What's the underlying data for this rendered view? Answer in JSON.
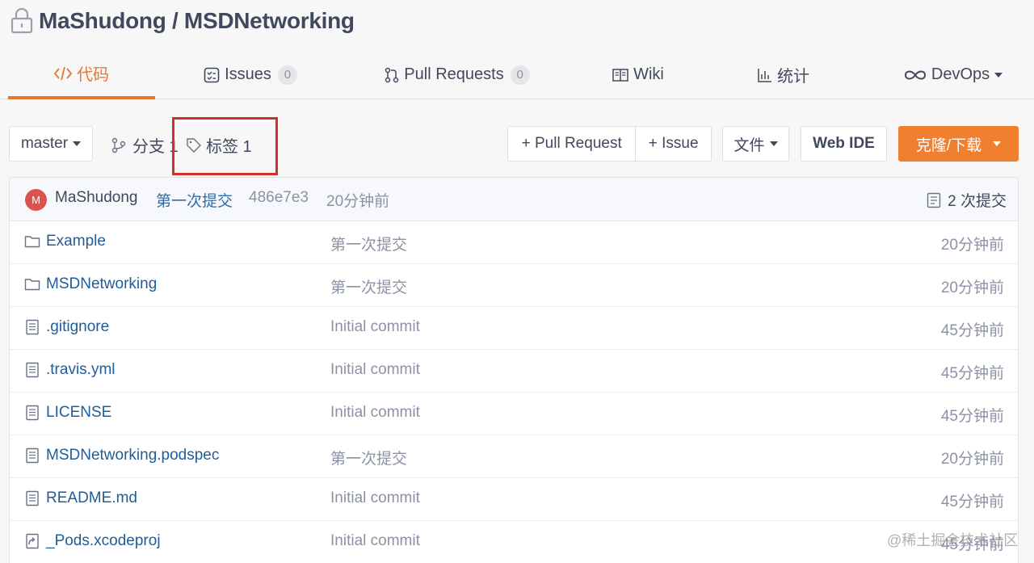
{
  "repo": {
    "title": "MaShudong / MSDNetworking"
  },
  "tabs": [
    {
      "label": "代码",
      "icon": "code-icon"
    },
    {
      "label": "Issues",
      "badge": "0",
      "icon": "issues-icon"
    },
    {
      "label": "Pull Requests",
      "badge": "0",
      "icon": "pull-request-icon"
    },
    {
      "label": "Wiki",
      "icon": "wiki-icon"
    },
    {
      "label": "统计",
      "icon": "chart-icon"
    },
    {
      "label": "DevOps",
      "icon": "infinity-icon"
    }
  ],
  "toolbar": {
    "branch": "master",
    "branches_label": "分支 1",
    "tags_label": "标签 1",
    "pull_request": "+ Pull Request",
    "issue": "+ Issue",
    "file": "文件",
    "web_ide": "Web IDE",
    "clone": "克隆/下载"
  },
  "last_commit": {
    "avatar_letter": "M",
    "author": "MaShudong",
    "message": "第一次提交",
    "sha": "486e7e3",
    "time": "20分钟前",
    "count": "2 次提交"
  },
  "files": [
    {
      "name": "Example",
      "type": "folder",
      "message": "第一次提交",
      "time": "20分钟前"
    },
    {
      "name": "MSDNetworking",
      "type": "folder",
      "message": "第一次提交",
      "time": "20分钟前"
    },
    {
      "name": ".gitignore",
      "type": "file",
      "message": "Initial commit",
      "time": "45分钟前"
    },
    {
      "name": ".travis.yml",
      "type": "file",
      "message": "Initial commit",
      "time": "45分钟前"
    },
    {
      "name": "LICENSE",
      "type": "file",
      "message": "Initial commit",
      "time": "45分钟前"
    },
    {
      "name": "MSDNetworking.podspec",
      "type": "file",
      "message": "第一次提交",
      "time": "20分钟前"
    },
    {
      "name": "README.md",
      "type": "file",
      "message": "Initial commit",
      "time": "45分钟前"
    },
    {
      "name": "_Pods.xcodeproj",
      "type": "symlink",
      "message": "Initial commit",
      "time": "45分钟前"
    }
  ],
  "watermark": "@稀土掘金技术社区",
  "colors": {
    "accent": "#e8772e",
    "link": "#1f5c99",
    "highlight": "#d0312d",
    "clone_button": "#f08030"
  }
}
